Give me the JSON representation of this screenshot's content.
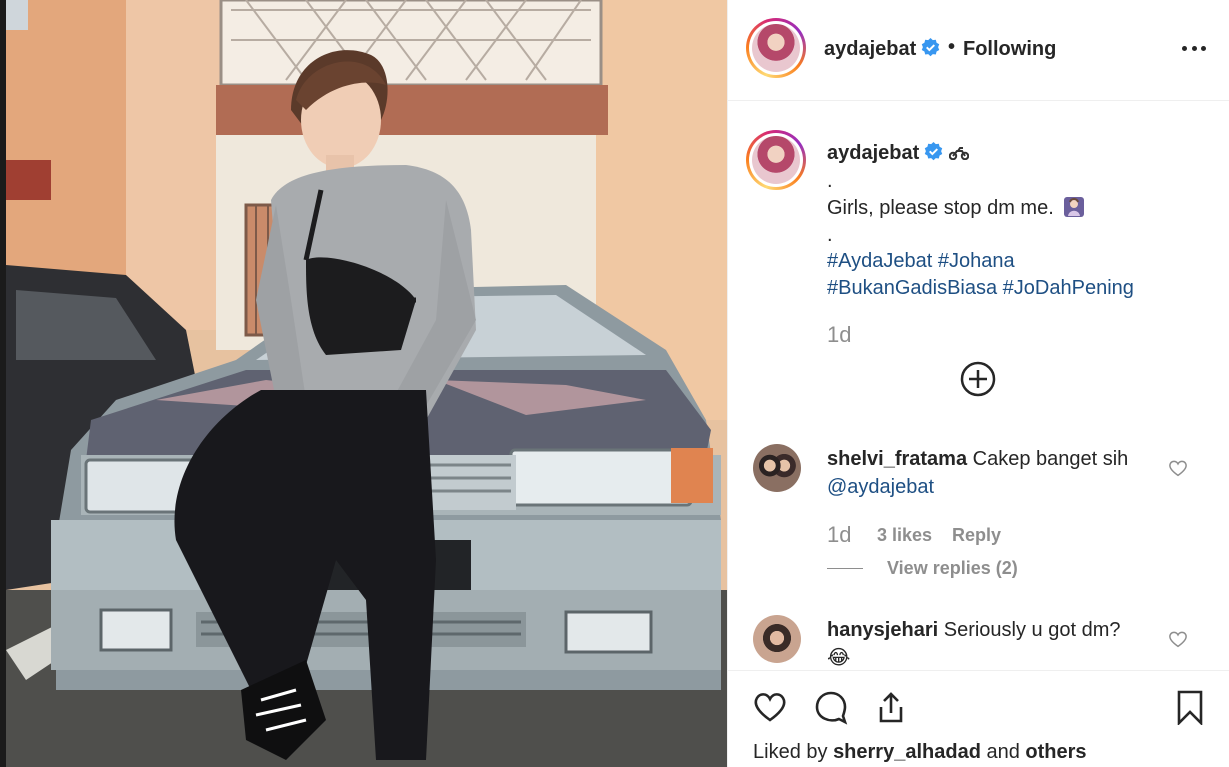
{
  "post": {
    "username": "aydajebat",
    "separator": "•",
    "follow_status": "Following"
  },
  "caption": {
    "username": "aydajebat",
    "dot1": ".",
    "text": "Girls, please stop dm me.",
    "dot2": ".",
    "hashtags_line1": [
      "#AydaJebat",
      "#Johana"
    ],
    "hashtags_line2": [
      "#BukanGadisBiasa",
      "#JoDahPening"
    ],
    "time": "1d"
  },
  "comments": [
    {
      "username": "shelvi_fratama",
      "text": "Cakep banget sih",
      "mention": "@aydajebat",
      "time": "1d",
      "likes": "3 likes",
      "reply": "Reply",
      "view_replies": "View replies (2)"
    },
    {
      "username": "hanysjehari",
      "text": "Seriously u got dm?",
      "emoji": "😂"
    }
  ],
  "footer": {
    "liked_prefix": "Liked by",
    "liked_user": "sherry_alhadad",
    "liked_join": "and",
    "liked_others": "others"
  },
  "icons": [
    "verified-badge-icon",
    "motorcycle-icon",
    "more-options-icon",
    "load-more-comments-icon",
    "heart-icon",
    "comment-icon",
    "share-icon",
    "bookmark-icon"
  ],
  "colors": {
    "text": "#262626",
    "secondary": "#8e8e8e",
    "hashtag": "#1e4f83",
    "verified": "#3897f0",
    "divider": "#efefef"
  }
}
